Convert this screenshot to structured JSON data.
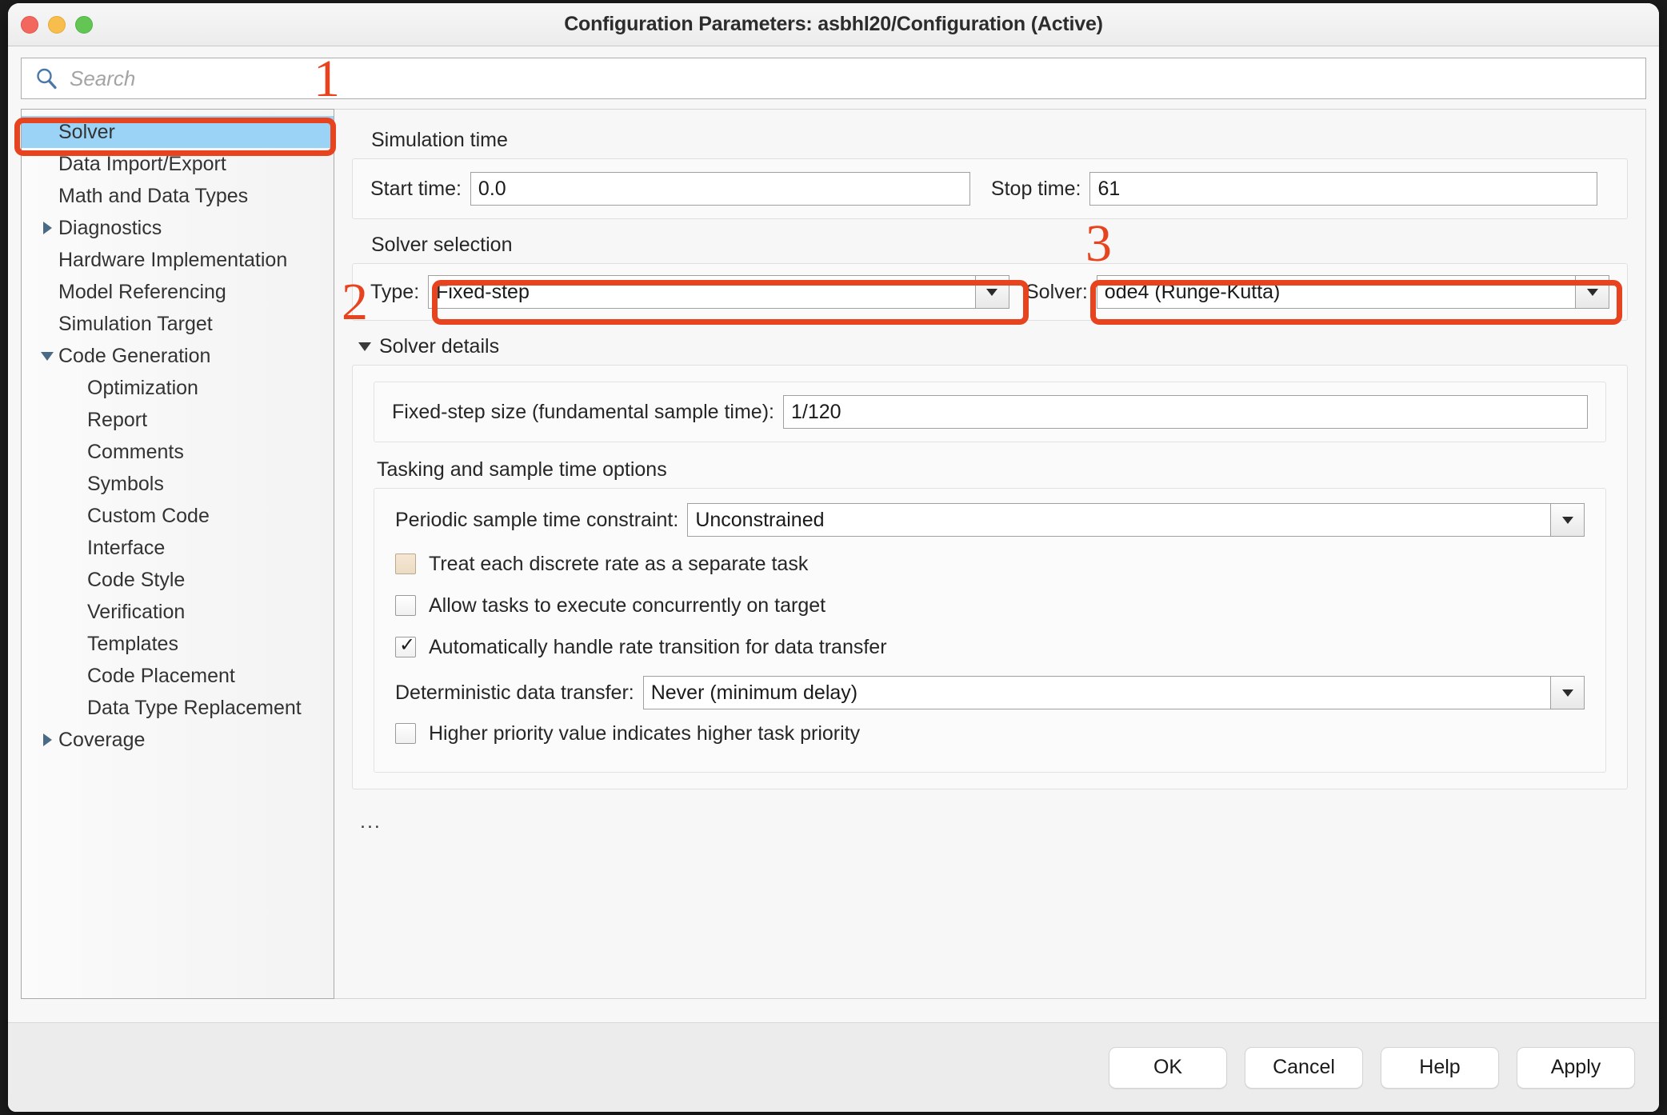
{
  "window": {
    "title": "Configuration Parameters: asbhl20/Configuration (Active)",
    "traffic_lights": [
      "close",
      "minimize",
      "zoom"
    ]
  },
  "search": {
    "placeholder": "Search",
    "value": "",
    "icon": "search-icon"
  },
  "sidebar": {
    "items": [
      {
        "label": "Solver",
        "level": 0,
        "arrow": "none",
        "selected": true
      },
      {
        "label": "Data Import/Export",
        "level": 0,
        "arrow": "none",
        "selected": false
      },
      {
        "label": "Math and Data Types",
        "level": 0,
        "arrow": "none",
        "selected": false
      },
      {
        "label": "Diagnostics",
        "level": 0,
        "arrow": "right",
        "selected": false
      },
      {
        "label": "Hardware Implementation",
        "level": 0,
        "arrow": "none",
        "selected": false
      },
      {
        "label": "Model Referencing",
        "level": 0,
        "arrow": "none",
        "selected": false
      },
      {
        "label": "Simulation Target",
        "level": 0,
        "arrow": "none",
        "selected": false
      },
      {
        "label": "Code Generation",
        "level": 0,
        "arrow": "down",
        "selected": false
      },
      {
        "label": "Optimization",
        "level": 1,
        "arrow": "none",
        "selected": false
      },
      {
        "label": "Report",
        "level": 1,
        "arrow": "none",
        "selected": false
      },
      {
        "label": "Comments",
        "level": 1,
        "arrow": "none",
        "selected": false
      },
      {
        "label": "Symbols",
        "level": 1,
        "arrow": "none",
        "selected": false
      },
      {
        "label": "Custom Code",
        "level": 1,
        "arrow": "none",
        "selected": false
      },
      {
        "label": "Interface",
        "level": 1,
        "arrow": "none",
        "selected": false
      },
      {
        "label": "Code Style",
        "level": 1,
        "arrow": "none",
        "selected": false
      },
      {
        "label": "Verification",
        "level": 1,
        "arrow": "none",
        "selected": false
      },
      {
        "label": "Templates",
        "level": 1,
        "arrow": "none",
        "selected": false
      },
      {
        "label": "Code Placement",
        "level": 1,
        "arrow": "none",
        "selected": false
      },
      {
        "label": "Data Type Replacement",
        "level": 1,
        "arrow": "none",
        "selected": false
      },
      {
        "label": "Coverage",
        "level": 0,
        "arrow": "right",
        "selected": false
      }
    ]
  },
  "content": {
    "simulation_time": {
      "heading": "Simulation time",
      "start_time_label": "Start time:",
      "start_time_value": "0.0",
      "stop_time_label": "Stop time:",
      "stop_time_value": "61"
    },
    "solver_selection": {
      "heading": "Solver selection",
      "type_label": "Type:",
      "type_value": "Fixed-step",
      "solver_label": "Solver:",
      "solver_value": "ode4 (Runge-Kutta)"
    },
    "solver_details": {
      "heading": "Solver details",
      "expanded": true,
      "fixed_step_label": "Fixed-step size (fundamental sample time):",
      "fixed_step_value": "1/120",
      "tasking_heading": "Tasking and sample time options",
      "periodic_label": "Periodic sample time constraint:",
      "periodic_value": "Unconstrained",
      "checkboxes": [
        {
          "label": "Treat each discrete rate as a separate task",
          "checked": false,
          "style": "beige"
        },
        {
          "label": "Allow tasks to execute concurrently on target",
          "checked": false,
          "style": "normal"
        },
        {
          "label": "Automatically handle rate transition for data transfer",
          "checked": true,
          "style": "normal"
        }
      ],
      "deterministic_label": "Deterministic data transfer:",
      "deterministic_value": "Never (minimum delay)",
      "priority_checkbox": {
        "label": "Higher priority value indicates higher task priority",
        "checked": false
      }
    },
    "ellipsis": "..."
  },
  "footer": {
    "ok_label": "OK",
    "cancel_label": "Cancel",
    "help_label": "Help",
    "apply_label": "Apply"
  },
  "annotations": {
    "accent_color": "#e8431f",
    "markers": [
      {
        "number": "1",
        "target": "sidebar-item-solver"
      },
      {
        "number": "2",
        "target": "solver-type-combo"
      },
      {
        "number": "3",
        "target": "solver-combo"
      }
    ]
  },
  "colors": {
    "selection_blue": "#9ad3f5",
    "annotation_red": "#e8431f",
    "window_chrome": "#ececec"
  }
}
